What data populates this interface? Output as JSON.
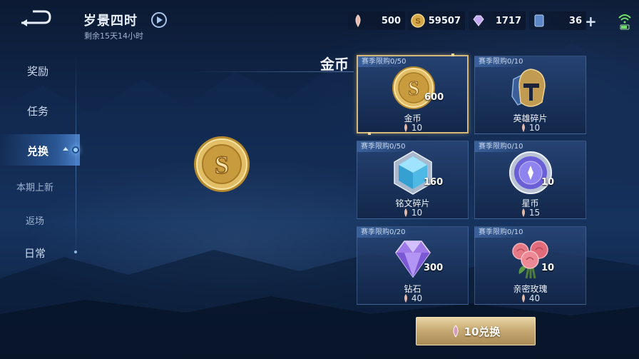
{
  "header": {
    "title": "岁景四时",
    "subtitle": "剩余15天14小时"
  },
  "currencies": [
    {
      "name": "spark",
      "icon": "feather-token-icon",
      "value": "500"
    },
    {
      "name": "gold",
      "icon": "gold-coin-icon",
      "value": "59507"
    },
    {
      "name": "diamond",
      "icon": "diamond-icon",
      "value": "1717"
    },
    {
      "name": "card",
      "icon": "coupon-card-icon",
      "value": "36"
    }
  ],
  "nav": {
    "items": [
      {
        "label": "奖励"
      },
      {
        "label": "任务"
      },
      {
        "label": "兑换",
        "active": true
      },
      {
        "label": "本期上新"
      },
      {
        "label": "返场"
      },
      {
        "label": "日常"
      }
    ]
  },
  "preview": {
    "title": "金币"
  },
  "shop": {
    "items": [
      {
        "limit": "赛季限购0/50",
        "name": "金币",
        "quantity": "600",
        "price": "10",
        "icon": "gold-coin-icon",
        "selected": true
      },
      {
        "limit": "赛季限购0/10",
        "name": "英雄碎片",
        "quantity": "",
        "price": "10",
        "icon": "hero-fragment-icon"
      },
      {
        "limit": "赛季限购0/50",
        "name": "铭文碎片",
        "quantity": "160",
        "price": "10",
        "icon": "inscription-fragment-icon"
      },
      {
        "limit": "赛季限购0/10",
        "name": "星币",
        "quantity": "10",
        "price": "15",
        "icon": "star-coin-icon"
      },
      {
        "limit": "赛季限购0/20",
        "name": "钻石",
        "quantity": "300",
        "price": "40",
        "icon": "diamond-icon"
      },
      {
        "limit": "赛季限购0/10",
        "name": "亲密玫瑰",
        "quantity": "10",
        "price": "40",
        "icon": "rose-bouquet-icon"
      }
    ]
  },
  "exchange_button": {
    "label": "10兑换"
  },
  "colors": {
    "gold_accent": "#d8b878",
    "background": "#142d55"
  }
}
